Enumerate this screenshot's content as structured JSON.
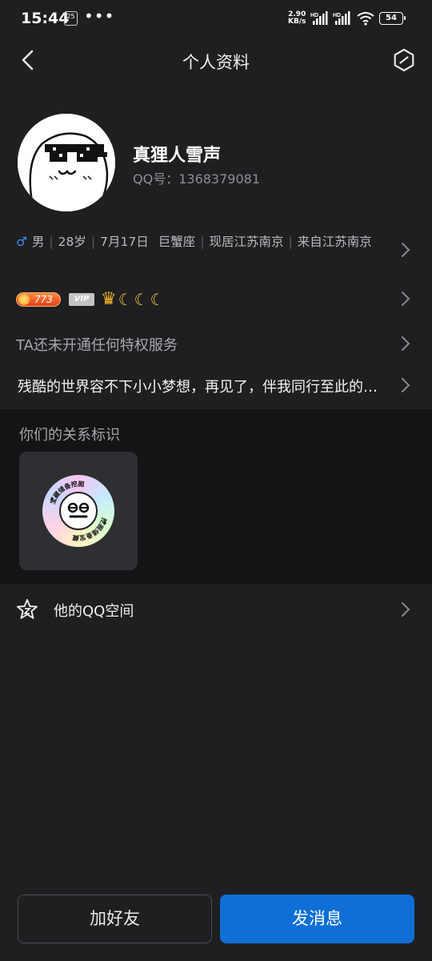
{
  "status_bar": {
    "time": "15:44",
    "calendar_day": "25",
    "more": "•••",
    "speed_value": "2.90",
    "speed_unit": "KB/s",
    "hd1": "HD",
    "hd2": "HD",
    "battery": "54"
  },
  "nav": {
    "title": "个人资料"
  },
  "profile": {
    "nickname": "真狸人雪声",
    "qq_label": "QQ号：",
    "qq_number": "1368379081",
    "gender_symbol": "♂",
    "gender": "男",
    "age": "28岁",
    "birthday": "7月17日",
    "zodiac": "巨蟹座",
    "location": "现居江苏南京",
    "hometown": "来自江苏南京",
    "level": "773",
    "vip": "VIP",
    "privilege_text": "TA还未开通任何特权服务",
    "signature": "残酷的世界容不下小小梦想，再见了，伴我同行至此的…"
  },
  "relation": {
    "title": "你们的关系标识",
    "badge_text_top": "宝藏储备挖掘",
    "badge_text_bottom": "挖掘储备宝藏"
  },
  "qzone": {
    "label": "他的QQ空间"
  },
  "buttons": {
    "add_friend": "加好友",
    "send_message": "发消息"
  },
  "colors": {
    "background": "#1e1f21",
    "section_dark": "#141416",
    "primary": "#0f6fd6",
    "male_blue": "#3f8ff0"
  }
}
